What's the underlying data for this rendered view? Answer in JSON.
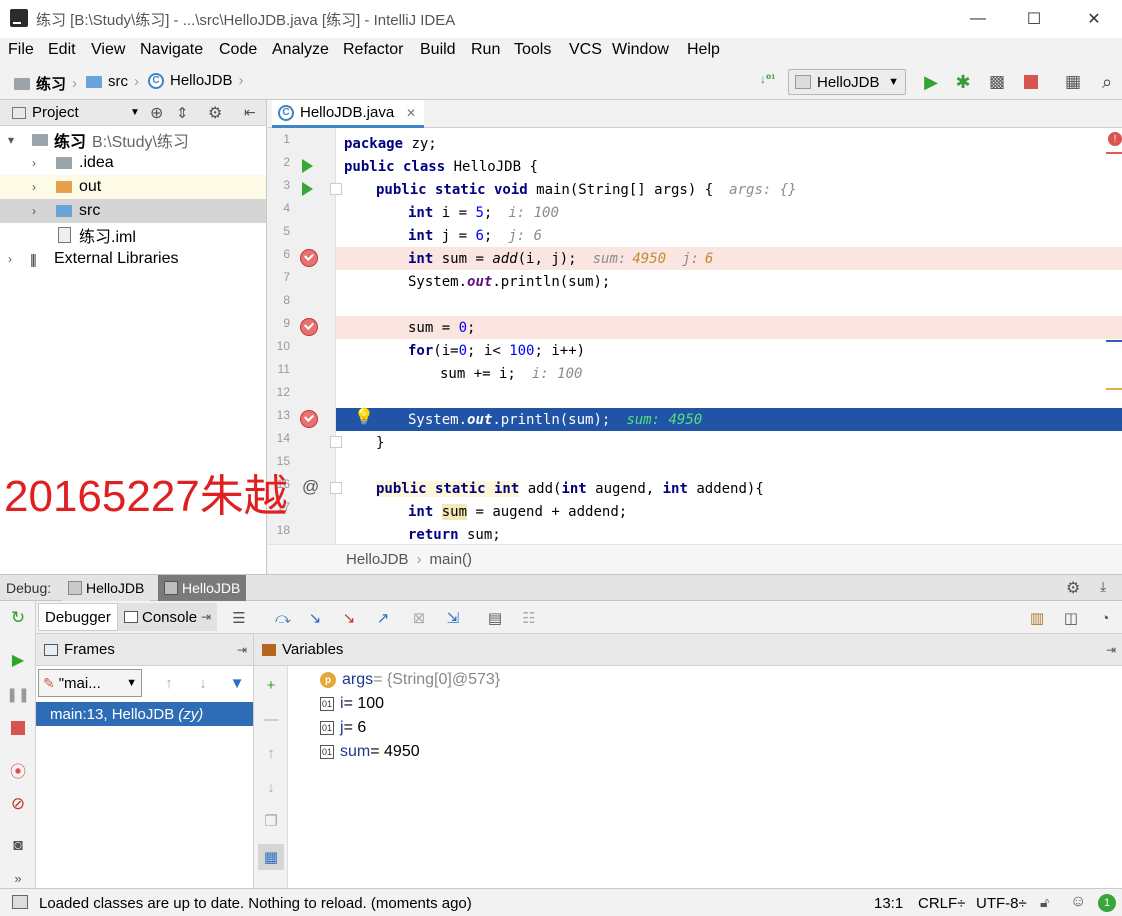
{
  "window": {
    "title": "练习 [B:\\Study\\练习] - ...\\src\\HelloJDB.java [练习] - IntelliJ IDEA",
    "minimize": "—",
    "maximize": "☐",
    "close": "✕"
  },
  "menu": [
    "File",
    "Edit",
    "View",
    "Navigate",
    "Code",
    "Analyze",
    "Refactor",
    "Build",
    "Run",
    "Tools",
    "VCS",
    "Window",
    "Help"
  ],
  "nav": {
    "crumbs": [
      "练习",
      "src",
      "HelloJDB"
    ],
    "run_config": "HelloJDB"
  },
  "project": {
    "header": "Project",
    "tree": [
      {
        "label": "练习",
        "suffix": "B:\\Study\\练习"
      },
      {
        "label": ".idea"
      },
      {
        "label": "out"
      },
      {
        "label": "src"
      },
      {
        "label": "练习.iml"
      },
      {
        "label": "External Libraries"
      }
    ]
  },
  "editor": {
    "tab": "HelloJDB.java",
    "lines": [
      "1",
      "2",
      "3",
      "4",
      "5",
      "6",
      "7",
      "8",
      "9",
      "10",
      "11",
      "12",
      "13",
      "14",
      "15",
      "16",
      "17",
      "18"
    ],
    "code": {
      "l1a": "package",
      "l1b": " zy;",
      "l2a": "public class",
      "l2b": " HelloJDB {",
      "l3a": "public static void",
      "l3b": " main(String[] args) {",
      "l3h": "args: {}",
      "l4a": "int",
      "l4b": " i = ",
      "l4c": "5",
      "l4d": ";",
      "l4h": "i: 100",
      "l5a": "int",
      "l5b": " j = ",
      "l5c": "6",
      "l5d": ";",
      "l5h": "j: 6",
      "l6a": "int",
      "l6b": " sum = ",
      "l6c": "add",
      "l6d": "(i, j);",
      "l6h1": "sum:",
      "l6v1": "4950",
      "l6h2": "j:",
      "l6v2": "6",
      "l7a": "System.",
      "l7b": "out",
      "l7c": ".println(sum);",
      "l9a": "sum = ",
      "l9b": "0",
      "l9c": ";",
      "l10a": "for",
      "l10b": "(i=",
      "l10c": "0",
      "l10d": "; i< ",
      "l10e": "100",
      "l10f": "; i++)",
      "l11a": "sum += i;",
      "l11h": "i: 100",
      "l13a": "System.",
      "l13b": "out",
      "l13c": ".println(sum);",
      "l13h": "sum: 4950",
      "l14a": "}",
      "l16a": "public static int",
      "l16b": " add(",
      "l16c": "int",
      "l16d": " augend, ",
      "l16e": "int",
      "l16f": " addend){",
      "l17a": "int",
      "l17b": "sum",
      "l17c": " = augend + addend;",
      "l18a": "return",
      "l18b": " sum;"
    },
    "breadcrumb": [
      "HelloJDB",
      "main()"
    ]
  },
  "watermark": "20165227朱越",
  "debug": {
    "label": "Debug:",
    "sessions": [
      "HelloJDB",
      "HelloJDB"
    ],
    "tabs": [
      "Debugger",
      "Console"
    ],
    "frames_header": "Frames",
    "thread": "\"mai...",
    "frame": "main:13, HelloJDB",
    "frame_pkg": "(zy)",
    "variables_header": "Variables",
    "vars": [
      {
        "name": "args",
        "value": " = {String[0]@573}"
      },
      {
        "name": "i",
        "value": " = 100"
      },
      {
        "name": "j",
        "value": " = 6"
      },
      {
        "name": "sum",
        "value": " = 4950"
      }
    ]
  },
  "status": {
    "message": "Loaded classes are up to date. Nothing to reload. (moments ago)",
    "position": "13:1",
    "line_sep": "CRLF÷",
    "encoding": "UTF-8÷",
    "notif_count": "1"
  },
  "colors": {
    "accent": "#4083c9",
    "exec_line": "#2154a6",
    "bp_line": "#fae5e0",
    "watermark": "#e02020"
  }
}
